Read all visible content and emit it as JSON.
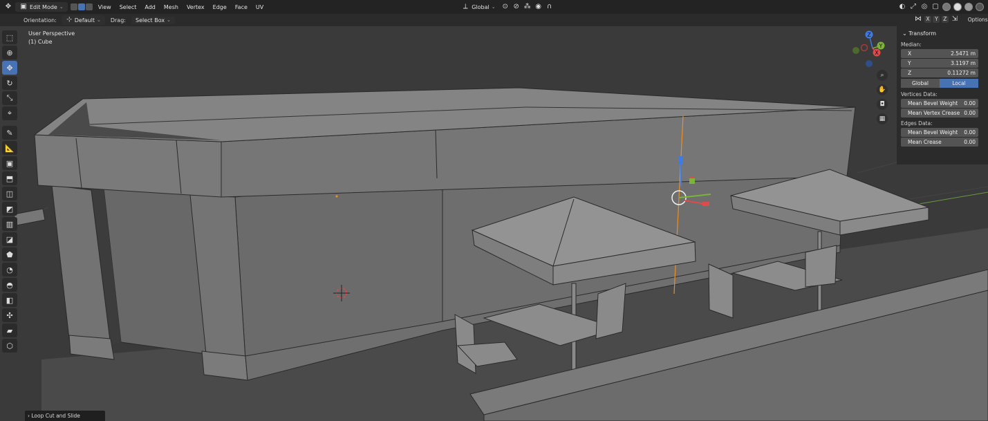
{
  "header": {
    "mode": "Edit Mode",
    "menus": [
      "View",
      "Select",
      "Add",
      "Mesh",
      "Vertex",
      "Edge",
      "Face",
      "UV"
    ],
    "transform_orientation": "Global"
  },
  "tool_settings": {
    "orientation_label": "Orientation:",
    "orientation_value": "Default",
    "drag_label": "Drag:",
    "drag_value": "Select Box",
    "options_label": "Options",
    "axis_x": "X",
    "axis_y": "Y",
    "axis_z": "Z"
  },
  "viewport": {
    "view_name": "User Perspective",
    "object_name": "(1) Cube",
    "gizmo_axes": {
      "x": "X",
      "y": "Y",
      "z": "Z"
    },
    "colors": {
      "x_axis": "#e04a4a",
      "y_axis": "#7cb43a",
      "z_axis": "#3f7be0",
      "edge_highlight": "#e8902a"
    }
  },
  "toolbar": {
    "tools": [
      "select-box",
      "cursor",
      "move",
      "rotate",
      "scale",
      "transform",
      "annotate",
      "measure",
      "add-cube",
      "extrude",
      "inset",
      "bevel",
      "loop-cut",
      "knife",
      "poly-build",
      "spin",
      "smooth",
      "edge-slide",
      "shrink-fatten",
      "shear",
      "rip-region"
    ],
    "active_tool": "move"
  },
  "npanel": {
    "title": "Transform",
    "median_label": "Median:",
    "median": [
      {
        "axis": "X",
        "value": "2.5471 m"
      },
      {
        "axis": "Y",
        "value": "3.1197 m"
      },
      {
        "axis": "Z",
        "value": "0.11272 m"
      }
    ],
    "space_options": [
      "Global",
      "Local"
    ],
    "active_space": "Local",
    "vertices_label": "Vertices Data:",
    "vertices_fields": [
      {
        "label": "Mean Bevel Weight",
        "value": "0.00"
      },
      {
        "label": "Mean Vertex Crease",
        "value": "0.00"
      }
    ],
    "edges_label": "Edges Data:",
    "edges_fields": [
      {
        "label": "Mean Bevel Weight",
        "value": "0.00"
      },
      {
        "label": "Mean Crease",
        "value": "0.00"
      }
    ]
  },
  "last_operator": "Loop Cut and Slide"
}
